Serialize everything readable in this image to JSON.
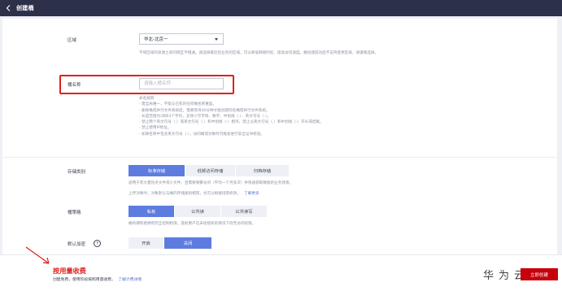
{
  "header": {
    "title": "创建桶",
    "back_icon": "chevron-left-icon"
  },
  "region": {
    "label": "区域",
    "selected": "华北-北京一",
    "help": "不同区域的资源之间内网互不相通。请选择靠近您业务的区域，可以降低网络时延、提高访问速度。桶创建成功后不支持变更区域，请谨慎选择。"
  },
  "bucket_name": {
    "label": "桶名称",
    "value": "",
    "placeholder": "请输入桶名称",
    "rules": [
      "命名规则:",
      "- 需全局唯一，不能与已有的任何桶名称重复。",
      "- 删除桶或并行文件系统后，需要等待30分钟才能创建同名桶或并行文件系统。",
      "- 长度范围为3到63个字符，支持小写字母、数字、中划线（-）、英文句号（.）。",
      "- 禁止两个英文句号（.）或英文句号（.）和中划线（-）相邻，禁止以英文句号（.）和中划线（-）开头或结尾。",
      "- 禁止使用IP地址。",
      "- 如果名称中包含英文句号（.），访问桶或对象时可能会进行安全证书校验。"
    ]
  },
  "storage_class": {
    "label": "存储类别",
    "options": [
      "标准存储",
      "低频访问存储",
      "归档存储"
    ],
    "selected_index": 0,
    "help_line1": "适用于有大量热点文件或小文件，且需要频繁访问（平均一个月多次）并快速获取数据的业务场景。",
    "help_line2": "上传对象时，对象默认与桶的存储类别相同，也可以根据场景修改。",
    "learn_more": "了解更多"
  },
  "bucket_policy": {
    "label": "桶策略",
    "options": [
      "私有",
      "公共读",
      "公共读写"
    ],
    "selected_index": 0,
    "help": "桶的拥有者拥有完全控制权限，其他用户在未经授权的情况下均无访问权限。"
  },
  "default_encryption": {
    "label": "默认加密",
    "help_icon": "question-circle-icon",
    "help_icon_glyph": "?",
    "options": [
      "开启",
      "关闭"
    ],
    "selected_index": 1
  },
  "footer": {
    "fee_title": "按用量收费",
    "fee_desc": "创建免费，使用阶段按照用量收费。",
    "fee_link": "了解计费详情",
    "brand": "华为云",
    "submit": "立即创建"
  },
  "colors": {
    "topbar": "#2c3049",
    "accent": "#5e7ce0",
    "highlight": "#e02020",
    "submit": "#c7000b"
  }
}
